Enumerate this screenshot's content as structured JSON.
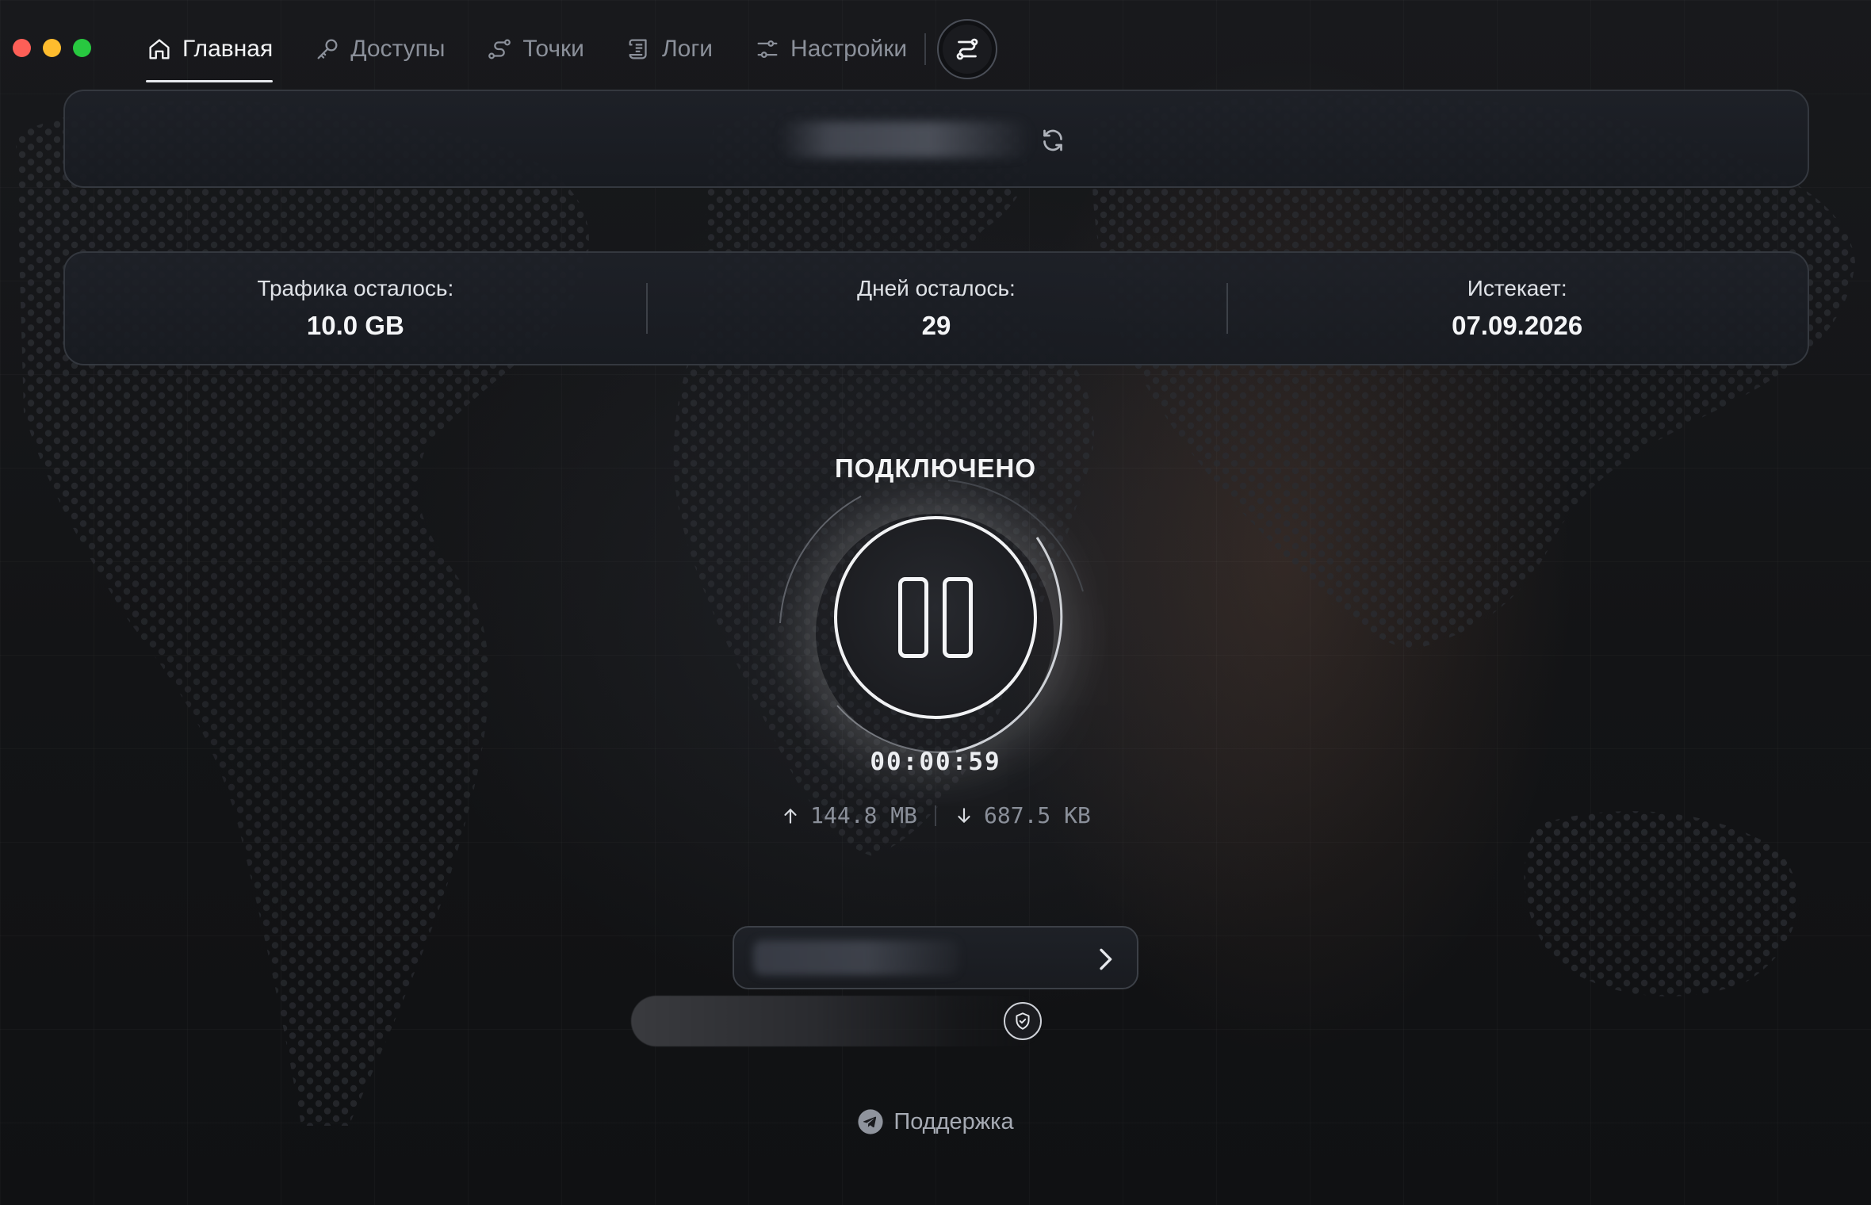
{
  "window": {
    "controls": [
      "close",
      "minimize",
      "maximize"
    ]
  },
  "nav": {
    "items": [
      {
        "label": "Главная",
        "icon": "home-icon",
        "active": true
      },
      {
        "label": "Доступы",
        "icon": "key-icon",
        "active": false
      },
      {
        "label": "Точки",
        "icon": "route-icon",
        "active": false
      },
      {
        "label": "Логи",
        "icon": "scroll-icon",
        "active": false
      },
      {
        "label": "Настройки",
        "icon": "sliders-icon",
        "active": false
      }
    ],
    "action_icon": "routing-toggle-icon"
  },
  "key_card": {
    "value_hidden": true,
    "refresh_icon": "refresh-icon"
  },
  "stats": {
    "traffic": {
      "label": "Трафика осталось:",
      "value": "10.0 GB"
    },
    "days": {
      "label": "Дней осталось:",
      "value": "29"
    },
    "expires": {
      "label": "Истекает:",
      "value": "07.09.2026"
    }
  },
  "connection": {
    "status": "ПОДКЛЮЧЕНО",
    "timer": "00:00:59",
    "upload": "144.8 MB",
    "download": "687.5 KB",
    "button_icon": "pause-icon"
  },
  "server": {
    "name_hidden": true,
    "chevron_icon": "chevron-right-icon"
  },
  "protection": {
    "icon": "shield-check-icon"
  },
  "support": {
    "label": "Поддержка",
    "icon": "telegram-icon"
  },
  "colors": {
    "background": "#111214",
    "card": "#1e2128",
    "card_border": "#34383f",
    "text_primary": "#f4f5f7",
    "text_muted": "#8b909a",
    "close": "#fe5f57",
    "minimize": "#febc2e",
    "maximize": "#28c840"
  }
}
